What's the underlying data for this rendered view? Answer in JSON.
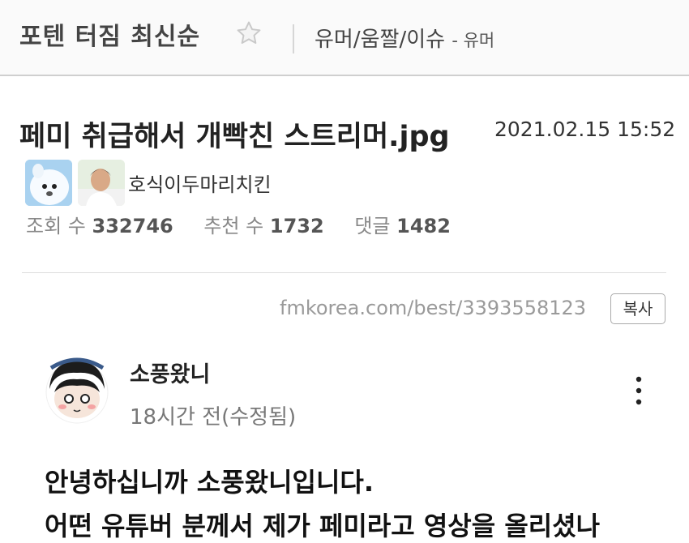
{
  "header": {
    "board_title": "포텐 터짐 최신순",
    "category": "유머/움짤/이슈",
    "category_sub": "- 유머"
  },
  "post": {
    "title": "페미 취급해서 개빡친 스트리머.jpg",
    "date": "2021.02.15 15:52",
    "author": "호식이두마리치킨",
    "stats": {
      "views_label": "조회 수",
      "views": "332746",
      "likes_label": "추천 수",
      "likes": "1732",
      "comments_label": "댓글",
      "comments": "1482"
    },
    "url": "fmkorea.com/best/3393558123",
    "copy_label": "복사"
  },
  "embedded": {
    "name": "소풍왔니",
    "time": "18시간 전(수정됨)",
    "line1": "안녕하십니까 소풍왔니입니다.",
    "line2": "어떤 유튜버 분께서 제가 페미라고 영상을 올리셨나"
  },
  "icons": [
    "star-icon",
    "kebab-menu-icon"
  ]
}
